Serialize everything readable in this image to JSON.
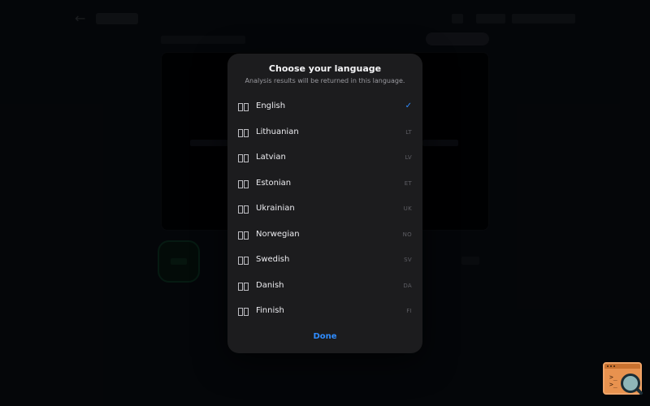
{
  "modal": {
    "title": "Choose your language",
    "subtitle": "Analysis results will be returned in this language.",
    "done_label": "Done",
    "selected_indicator": "✓",
    "languages": [
      {
        "name": "English",
        "code": "",
        "selected": true
      },
      {
        "name": "Lithuanian",
        "code": "LT",
        "selected": false
      },
      {
        "name": "Latvian",
        "code": "LV",
        "selected": false
      },
      {
        "name": "Estonian",
        "code": "ET",
        "selected": false
      },
      {
        "name": "Ukrainian",
        "code": "UK",
        "selected": false
      },
      {
        "name": "Norwegian",
        "code": "NO",
        "selected": false
      },
      {
        "name": "Swedish",
        "code": "SV",
        "selected": false
      },
      {
        "name": "Danish",
        "code": "DA",
        "selected": false
      },
      {
        "name": "Finnish",
        "code": "FI",
        "selected": false
      }
    ]
  },
  "colors": {
    "accent": "#2f8cff",
    "modal_bg": "#1c1c1e",
    "overlay": "#000000"
  },
  "icons": {
    "flag": "flag-icon",
    "check": "checkmark-icon",
    "back": "back-arrow-icon",
    "corner_widget": "terminal-search-icon"
  }
}
